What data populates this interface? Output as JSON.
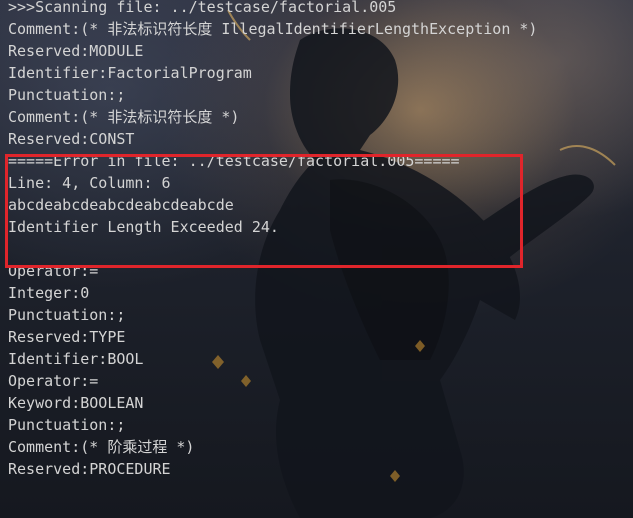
{
  "terminal": {
    "lines": [
      ">>>Scanning file: ../testcase/factorial.005",
      "Comment:(* 非法标识符长度 IllegalIdentifierLengthException *)",
      "Reserved:MODULE",
      "Identifier:FactorialProgram",
      "Punctuation:;",
      "Comment:(* 非法标识符长度 *)",
      "Reserved:CONST",
      "=====Error in file: ../testcase/factorial.005=====",
      "Line: 4, Column: 6",
      "abcdeabcdeabcdeabcdeabcde",
      "Identifier Length Exceeded 24.",
      "",
      "Operator:=",
      "Integer:0",
      "Punctuation:;",
      "Reserved:TYPE",
      "Identifier:BOOL",
      "Operator:=",
      "Keyword:BOOLEAN",
      "Punctuation:;",
      "Comment:(* 阶乘过程 *)",
      "Reserved:PROCEDURE"
    ]
  },
  "colors": {
    "text": "#d4d4d4",
    "highlight_border": "#e0252b"
  }
}
